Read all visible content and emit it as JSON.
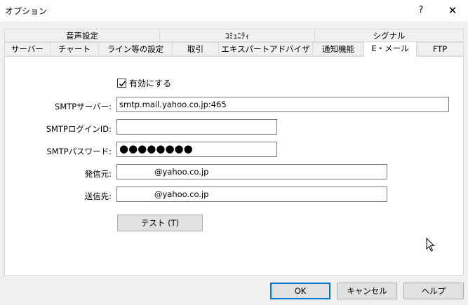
{
  "window": {
    "title": "オプション",
    "help_label": "?",
    "close_label": "✕"
  },
  "tabs_row1": [
    {
      "label": "音声設定"
    },
    {
      "label": "ｺﾐｭﾆﾃｨ"
    },
    {
      "label": "シグナル"
    }
  ],
  "tabs_row2": [
    {
      "label": "サーバー"
    },
    {
      "label": "チャート"
    },
    {
      "label": "ライン等の設定"
    },
    {
      "label": "取引"
    },
    {
      "label": "エキスパートアドバイザ"
    },
    {
      "label": "通知機能"
    },
    {
      "label": "E・メール",
      "active": true
    },
    {
      "label": "FTP"
    }
  ],
  "email": {
    "enable_label": "有効にする",
    "enable_checked": true,
    "smtp_server_label": "SMTPサーバー:",
    "smtp_server_value": "smtp.mail.yahoo.co.jp:465",
    "smtp_login_label": "SMTPログインID:",
    "smtp_login_value": "",
    "smtp_password_label": "SMTPパスワード:",
    "smtp_password_value": "●●●●●●●●",
    "from_label": "発信元:",
    "from_value": "@yahoo.co.jp",
    "to_label": "送信先:",
    "to_value": "@yahoo.co.jp",
    "test_button": "テスト (T)"
  },
  "footer": {
    "ok": "OK",
    "cancel": "キャンセル",
    "help": "ヘルプ"
  }
}
